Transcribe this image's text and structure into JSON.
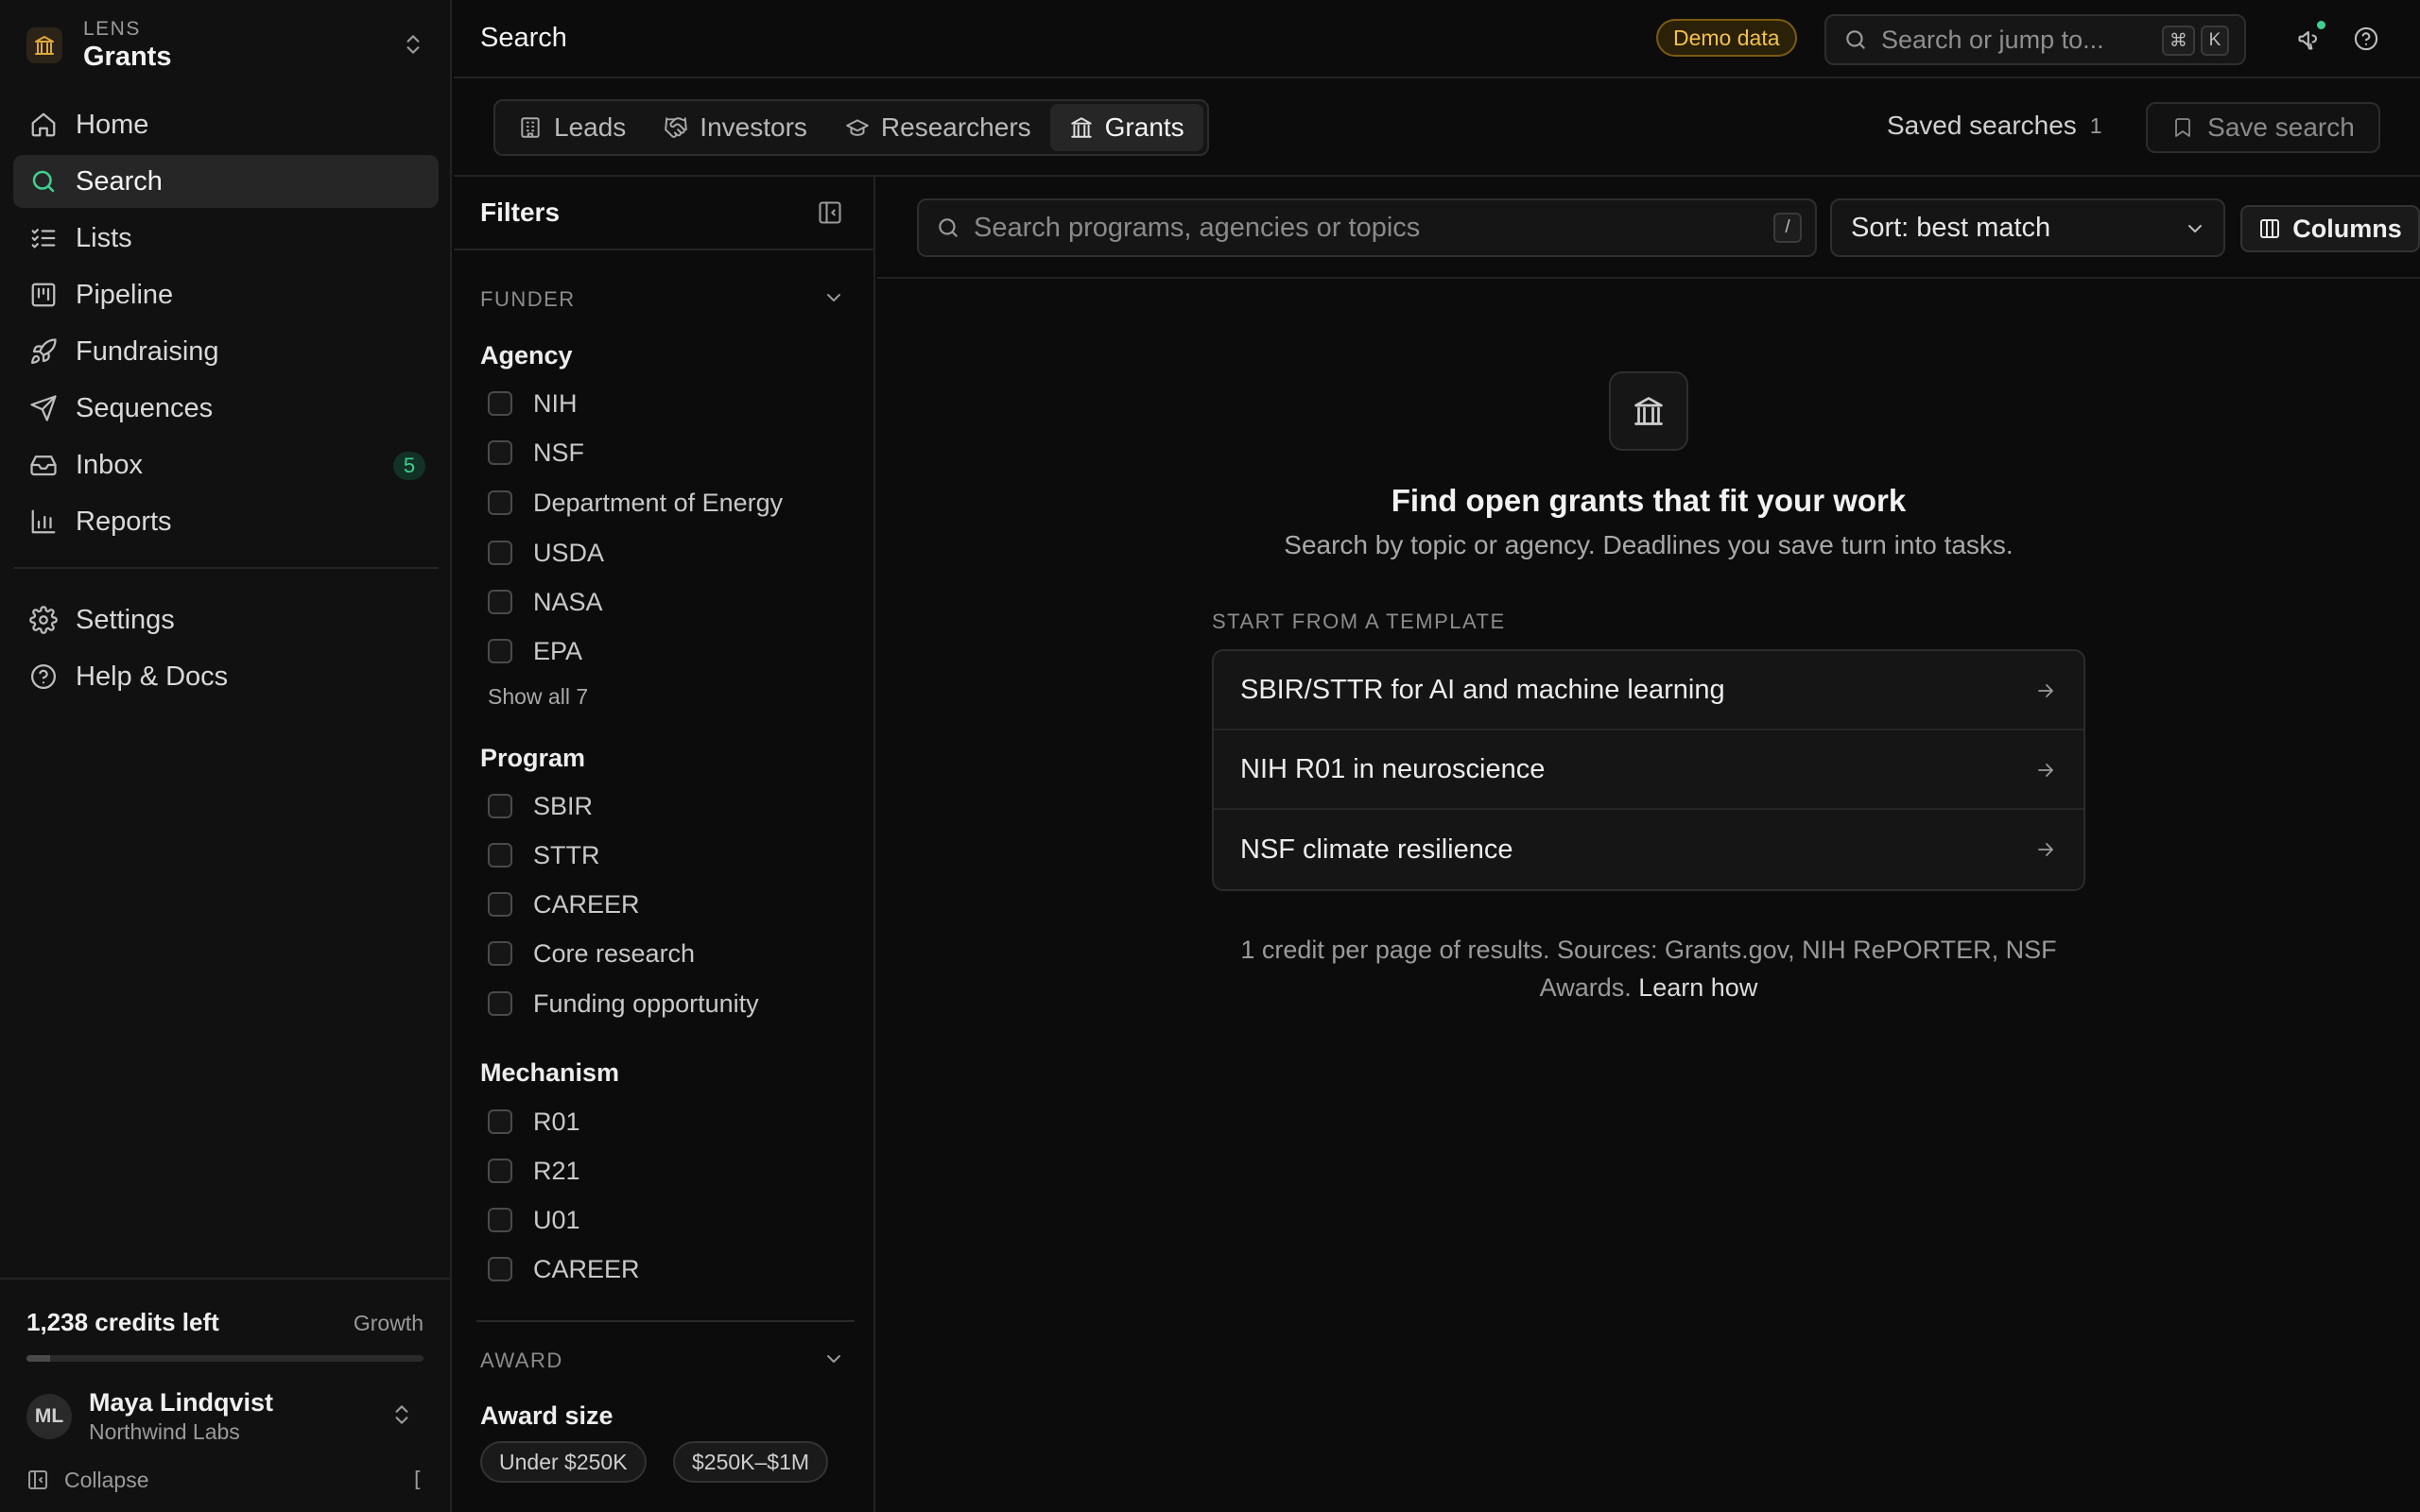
{
  "brand": {
    "sub": "LENS",
    "title": "Grants"
  },
  "nav": {
    "items": [
      {
        "label": "Home",
        "icon": "home-icon"
      },
      {
        "label": "Search",
        "icon": "search-icon",
        "active": true
      },
      {
        "label": "Lists",
        "icon": "list-icon"
      },
      {
        "label": "Pipeline",
        "icon": "kanban-icon"
      },
      {
        "label": "Fundraising",
        "icon": "rocket-icon"
      },
      {
        "label": "Sequences",
        "icon": "send-icon"
      },
      {
        "label": "Inbox",
        "icon": "inbox-icon",
        "badge": "5"
      },
      {
        "label": "Reports",
        "icon": "bar-chart-icon"
      }
    ],
    "secondary": [
      {
        "label": "Settings",
        "icon": "gear-icon"
      },
      {
        "label": "Help & Docs",
        "icon": "help-icon"
      }
    ]
  },
  "credits": {
    "label": "1,238 credits left",
    "plan": "Growth",
    "used_fraction": 0.06
  },
  "user": {
    "initials": "ML",
    "name": "Maya Lindqvist",
    "org": "Northwind Labs"
  },
  "collapse": {
    "label": "Collapse",
    "shortcut": "["
  },
  "header": {
    "title": "Search",
    "demo_badge": "Demo data",
    "search_placeholder": "Search or jump to...",
    "shortcut_keys": [
      "⌘",
      "K"
    ]
  },
  "tabs": [
    {
      "label": "Leads",
      "icon": "building-icon"
    },
    {
      "label": "Investors",
      "icon": "handshake-icon"
    },
    {
      "label": "Researchers",
      "icon": "graduation-cap-icon"
    },
    {
      "label": "Grants",
      "icon": "landmark-icon",
      "active": true
    }
  ],
  "saved_searches": {
    "label": "Saved searches",
    "count": "1"
  },
  "save_search": {
    "label": "Save search"
  },
  "filters": {
    "title": "Filters",
    "funder": {
      "label": "FUNDER",
      "agency": {
        "title": "Agency",
        "options": [
          "NIH",
          "NSF",
          "Department of Energy",
          "USDA",
          "NASA",
          "EPA"
        ],
        "show_all": "Show all 7"
      },
      "program": {
        "title": "Program",
        "options": [
          "SBIR",
          "STTR",
          "CAREER",
          "Core research",
          "Funding opportunity"
        ]
      },
      "mechanism": {
        "title": "Mechanism",
        "options": [
          "R01",
          "R21",
          "U01",
          "CAREER"
        ]
      }
    },
    "award": {
      "label": "AWARD",
      "award_size": {
        "title": "Award size",
        "chips": [
          "Under $250K",
          "$250K–$1M"
        ]
      }
    }
  },
  "main": {
    "search_placeholder": "Search programs, agencies or topics",
    "search_shortcut": "/",
    "sort_label": "Sort: best match",
    "columns_label": "Columns",
    "empty_title": "Find open grants that fit your work",
    "empty_subtitle": "Search by topic or agency. Deadlines you save turn into tasks.",
    "templates_label": "START FROM A TEMPLATE",
    "templates": [
      "SBIR/STTR for AI and machine learning",
      "NIH R01 in neuroscience",
      "NSF climate resilience"
    ],
    "footnote": "1 credit per page of results. Sources: Grants.gov, NIH RePORTER, NSF Awards.",
    "learn_how": "Learn how"
  },
  "colors": {
    "accent_green": "#3fd08e",
    "demo_amber": "#f2c14e",
    "background": "#0c0c0c"
  }
}
